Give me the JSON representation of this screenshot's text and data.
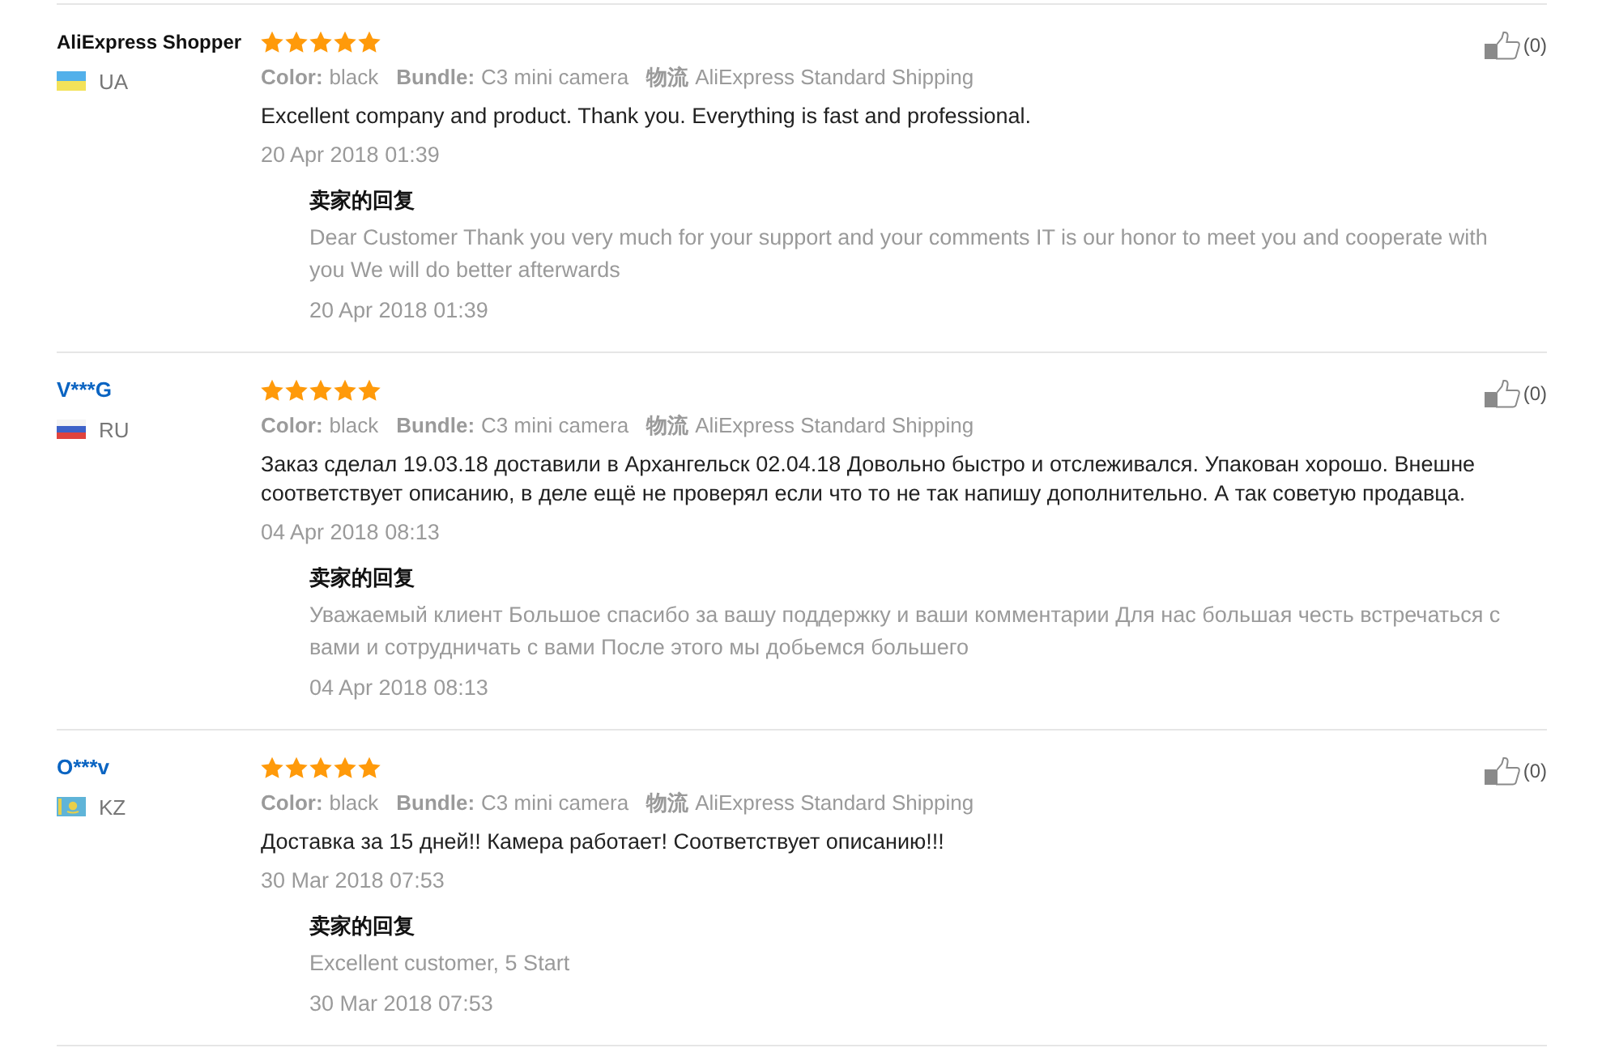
{
  "reviews": [
    {
      "reviewer": {
        "name": "AliExpress Shopper",
        "is_link": false,
        "country": "UA",
        "flag": {
          "kind": "ua"
        }
      },
      "stars": 5,
      "specs": [
        {
          "label": "Color:",
          "value": "black"
        },
        {
          "label": "Bundle:",
          "value": "C3 mini camera"
        },
        {
          "label": "物流",
          "value": "AliExpress Standard Shipping"
        }
      ],
      "text": "Excellent company and product. Thank you. Everything is fast and professional.",
      "date": "20 Apr 2018 01:39",
      "likes": "(0)",
      "seller_reply": {
        "title": "卖家的回复",
        "text": "Dear Customer Thank you very much for your support and your comments IT is our honor to meet you and cooperate with you We will do better afterwards",
        "date": "20 Apr 2018 01:39"
      }
    },
    {
      "reviewer": {
        "name": "V***G",
        "is_link": true,
        "country": "RU",
        "flag": {
          "kind": "ru"
        }
      },
      "stars": 5,
      "specs": [
        {
          "label": "Color:",
          "value": "black"
        },
        {
          "label": "Bundle:",
          "value": "C3 mini camera"
        },
        {
          "label": "物流",
          "value": "AliExpress Standard Shipping"
        }
      ],
      "text": "Заказ сделал 19.03.18 доставили в Архангельск 02.04.18 Довольно быстро и отслеживался. Упакован хорошо. Внешне соответствует описанию, в деле ещё не проверял если что то не так напишу дополнительно. А так советую продавца.",
      "date": "04 Apr 2018 08:13",
      "likes": "(0)",
      "seller_reply": {
        "title": "卖家的回复",
        "text": "Уважаемый клиент Большое спасибо за вашу поддержку и ваши комментарии Для нас большая честь встречаться с вами и сотрудничать с вами После этого мы добьемся большего",
        "date": "04 Apr 2018 08:13"
      }
    },
    {
      "reviewer": {
        "name": "O***v",
        "is_link": true,
        "country": "KZ",
        "flag": {
          "kind": "kz"
        }
      },
      "stars": 5,
      "specs": [
        {
          "label": "Color:",
          "value": "black"
        },
        {
          "label": "Bundle:",
          "value": "C3 mini camera"
        },
        {
          "label": "物流",
          "value": "AliExpress Standard Shipping"
        }
      ],
      "text": "Доставка за 15 дней!! Камера работает! Соответствует описанию!!!",
      "date": "30 Mar 2018 07:53",
      "likes": "(0)",
      "seller_reply": {
        "title": "卖家的回复",
        "text": "Excellent customer, 5 Start",
        "date": "30 Mar 2018 07:53"
      }
    }
  ]
}
